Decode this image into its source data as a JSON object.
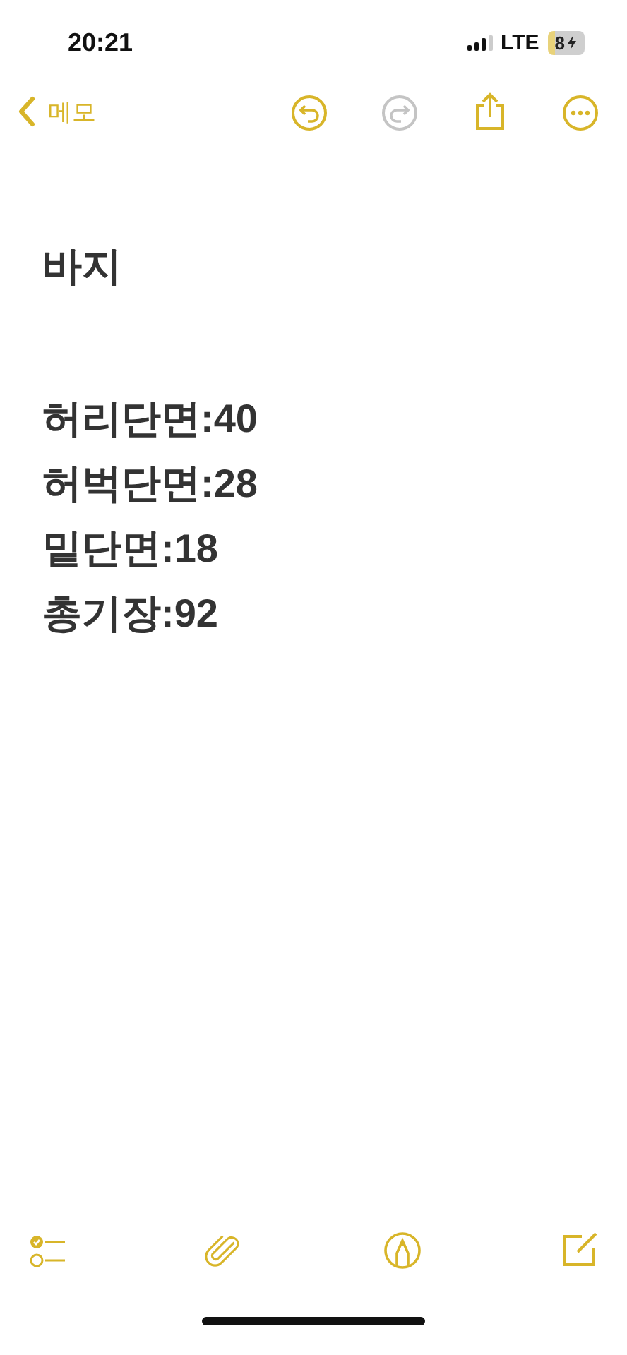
{
  "status_bar": {
    "time": "20:21",
    "network": "LTE",
    "battery": "8"
  },
  "nav": {
    "back_label": "메모",
    "actions": [
      {
        "kind": "undo",
        "disabled": false
      },
      {
        "kind": "redo",
        "disabled": true
      },
      {
        "kind": "share",
        "disabled": false
      },
      {
        "kind": "more",
        "disabled": false
      }
    ]
  },
  "note": {
    "title": "바지",
    "lines": [
      "허리단면:40",
      "허벅단면:28",
      "밑단면:18",
      "총기장:92"
    ]
  },
  "toolbar": [
    {
      "kind": "checklist"
    },
    {
      "kind": "attach"
    },
    {
      "kind": "markup"
    },
    {
      "kind": "compose"
    }
  ]
}
